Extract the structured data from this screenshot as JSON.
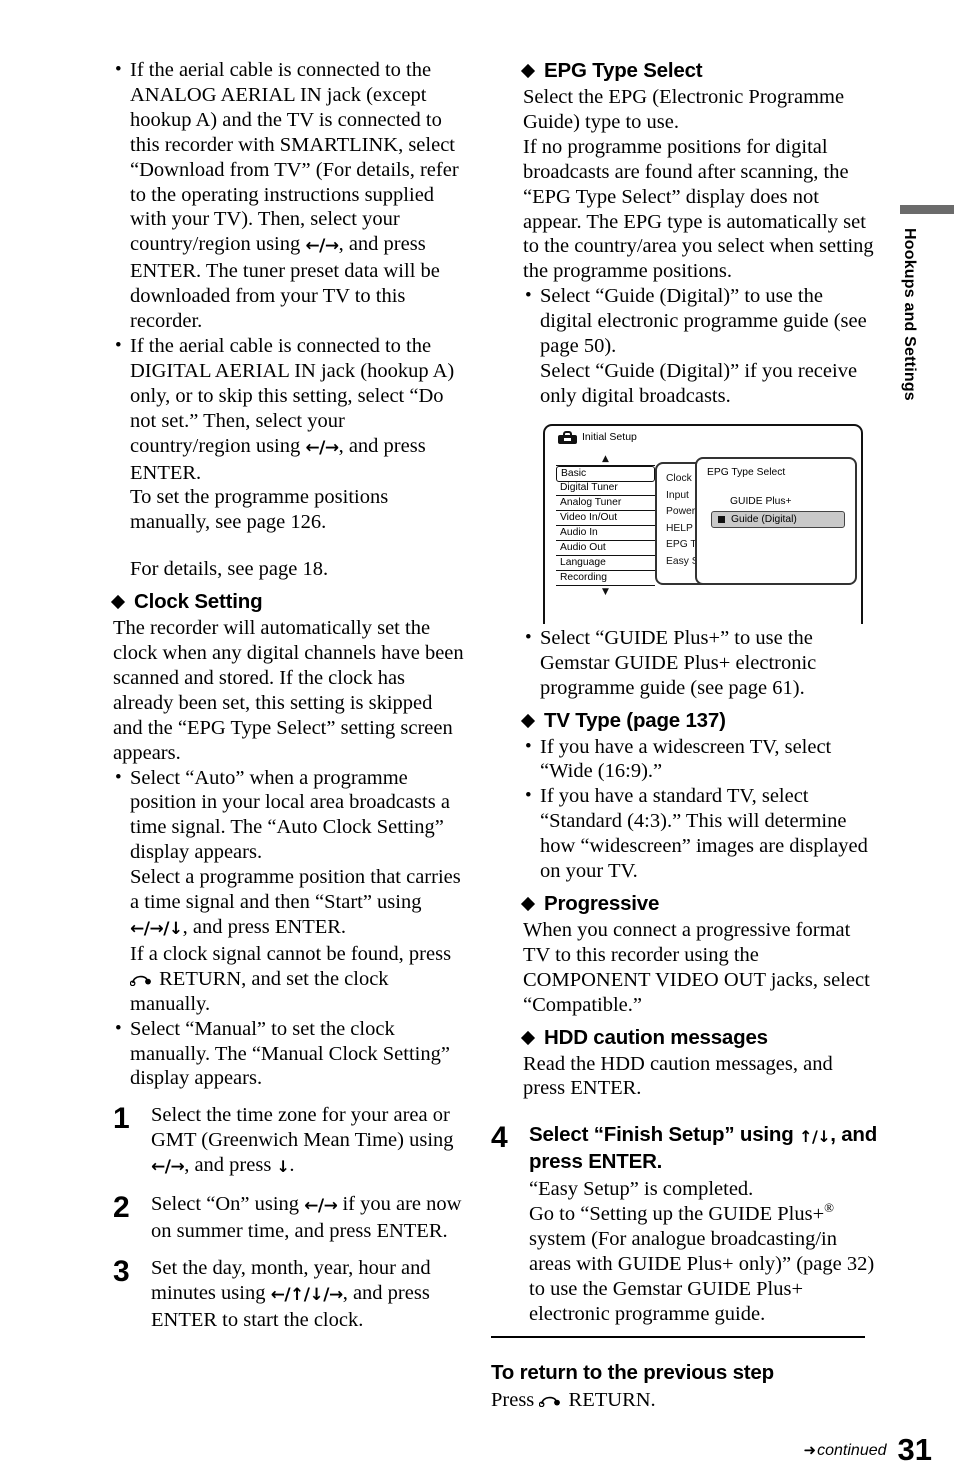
{
  "page_number": "31",
  "side_tab": {
    "label": "Hookups and Settings",
    "bar_color": "#6b6b6b"
  },
  "left_column": {
    "bullet_analog": "If the aerial cable is connected to the ANALOG AERIAL IN jack (except hookup A) and the TV is connected to this recorder with SMARTLINK, select “Download from TV” (For details, refer to the operating instructions supplied with your TV). Then, select your country/region using ",
    "bullet_analog_tail": ", and press ENTER. The tuner preset data will be downloaded from your TV to this recorder.",
    "bullet_digital": "If the aerial cable is connected to the DIGITAL AERIAL IN jack (hookup A) only, or to skip this setting, select “Do not set.” Then, select your country/region using ",
    "bullet_digital_tail": ", and press ENTER.",
    "manual_positions": "To set the programme positions manually, see page 126.",
    "for_details": "For details, see page 18.",
    "clock_setting_head": "Clock Setting",
    "clock_setting_body": "The recorder will automatically set the clock when any digital channels have been scanned and stored. If the clock has already been set, this setting is skipped and the “EPG Type Select” setting screen appears.",
    "bullet_auto": "Select “Auto” when a programme position in your local area broadcasts a time signal. The “Auto Clock Setting” display appears.",
    "auto_para_a": "Select a programme position that carries a time signal and then “Start” using ",
    "auto_para_a_tail": ", and press ENTER.",
    "auto_para_b_pre": "If a clock signal cannot be found, press ",
    "auto_para_b_post": " RETURN, and set the clock manually.",
    "bullet_manual": "Select “Manual” to set the clock manually. The “Manual Clock Setting” display appears.",
    "steps": [
      {
        "num": "1",
        "text_pre": "Select the time zone for your area or GMT (Greenwich Mean Time) using ",
        "text_mid": ", and press ",
        "text_post": "."
      },
      {
        "num": "2",
        "text_pre": "Select “On” using ",
        "text_mid": " if you are now on summer time, and press ENTER.",
        "text_post": ""
      },
      {
        "num": "3",
        "text_pre": "Set the day, month, year, hour and minutes using ",
        "text_mid": ", and press ENTER to start the clock.",
        "text_post": ""
      }
    ]
  },
  "right_column": {
    "epg_head": "EPG Type Select",
    "epg_body1": "Select the EPG (Electronic Programme Guide) type to use.",
    "epg_body2": "If no programme positions for digital broadcasts are found after scanning, the “EPG Type Select” display does not appear. The EPG type is automatically set to the country/area you select when setting the programme positions.",
    "epg_bullet_guide": "Select “Guide (Digital)” to use the digital electronic programme guide (see page 50).",
    "epg_bullet_guide_sub": "Select “Guide (Digital)” if you receive only digital broadcasts.",
    "epg_bullet_gplus": "Select “GUIDE Plus+” to use the Gemstar GUIDE Plus+ electronic programme guide (see page 61).",
    "tvtype_head": "TV Type (page 137)",
    "tvtype_bullet1": "If you have a widescreen TV, select “Wide (16:9).”",
    "tvtype_bullet2": "If you have a standard TV, select “Standard (4:3).” This will determine how “widescreen” images are displayed on your TV.",
    "progressive_head": "Progressive",
    "progressive_body": "When you connect a progressive format TV to this recorder using the COMPONENT VIDEO OUT jacks, select “Compatible.”",
    "hdd_head": "HDD caution messages",
    "hdd_body": "Read the HDD caution messages, and press ENTER.",
    "step4": {
      "num": "4",
      "title_pre": "Select “Finish Setup” using ",
      "title_post": ", and press ENTER.",
      "desc1": "“Easy Setup” is completed.",
      "desc2_pre": "Go to “Setting up the GUIDE Plus+",
      "desc2_sup": "®",
      "desc2_post": " system (For analogue broadcasting/in areas with GUIDE Plus+ only)” (page 32) to use the Gemstar GUIDE Plus+ electronic programme guide."
    }
  },
  "diagram": {
    "title": "Initial Setup",
    "menu_left": [
      "Basic",
      "Digital Tuner",
      "Analog Tuner",
      "Video In/Out",
      "Audio In",
      "Audio Out",
      "Language",
      "Recording"
    ],
    "menu_left_selected": "Basic",
    "caret_up": "▲",
    "caret_down": "▼",
    "menu_mid": [
      "Clock",
      "Input",
      "Power",
      "HELP",
      "EPG T",
      "Easy S"
    ],
    "menu_mid_selected": "Easy S",
    "epg_panel_title": "EPG Type Select",
    "epg_option_1": "GUIDE Plus+",
    "epg_option_2": "Guide (Digital)"
  },
  "bottom": {
    "heading": "To return to the previous step",
    "text_pre": "Press ",
    "text_post": " RETURN."
  },
  "footer": {
    "continued": "continued",
    "arrow": "➜"
  },
  "arrows": {
    "left_right": "←/→",
    "left_right_down": "←/→/↓",
    "left_up_down_right": "←/↑/↓/→",
    "down": "↓",
    "up_down": "↑/↓"
  }
}
